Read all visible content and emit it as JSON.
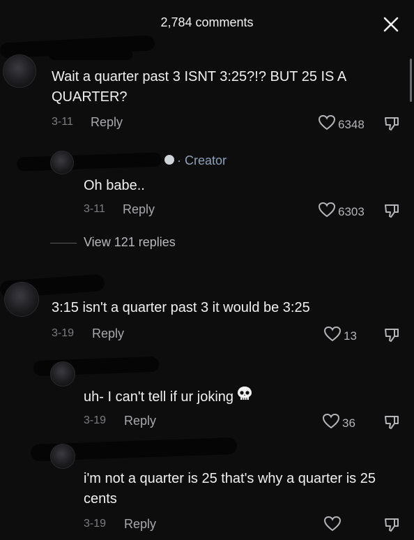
{
  "header": {
    "comments_count": "2,784 comments",
    "close_icon": "close-x-icon"
  },
  "comments": [
    {
      "text": "Wait a quarter past 3 ISNT 3:25?!? BUT 25 IS A QUARTER?",
      "date": "3-11",
      "reply": "Reply",
      "likes": "6348"
    },
    {
      "creator_label": "Creator",
      "text": "Oh babe..",
      "date": "3-11",
      "reply": "Reply",
      "likes": "6303",
      "view_replies": "View 121 replies"
    },
    {
      "text": "3:15 isn't a quarter past 3 it would be 3:25",
      "date": "3-19",
      "reply": "Reply",
      "likes": "13"
    },
    {
      "text": "uh- I can't tell if ur joking",
      "emoji": "skull-emoji",
      "date": "3-19",
      "reply": "Reply",
      "likes": "36"
    },
    {
      "text": "i'm not a quarter is 25 that's why a quarter is 25 cents",
      "date": "3-19",
      "reply": "Reply",
      "likes": ""
    }
  ],
  "colors": {
    "background": "#0d0d0e",
    "text": "#f1f1f1",
    "muted": "#7d7d82",
    "creator": "#8ea1b8"
  }
}
